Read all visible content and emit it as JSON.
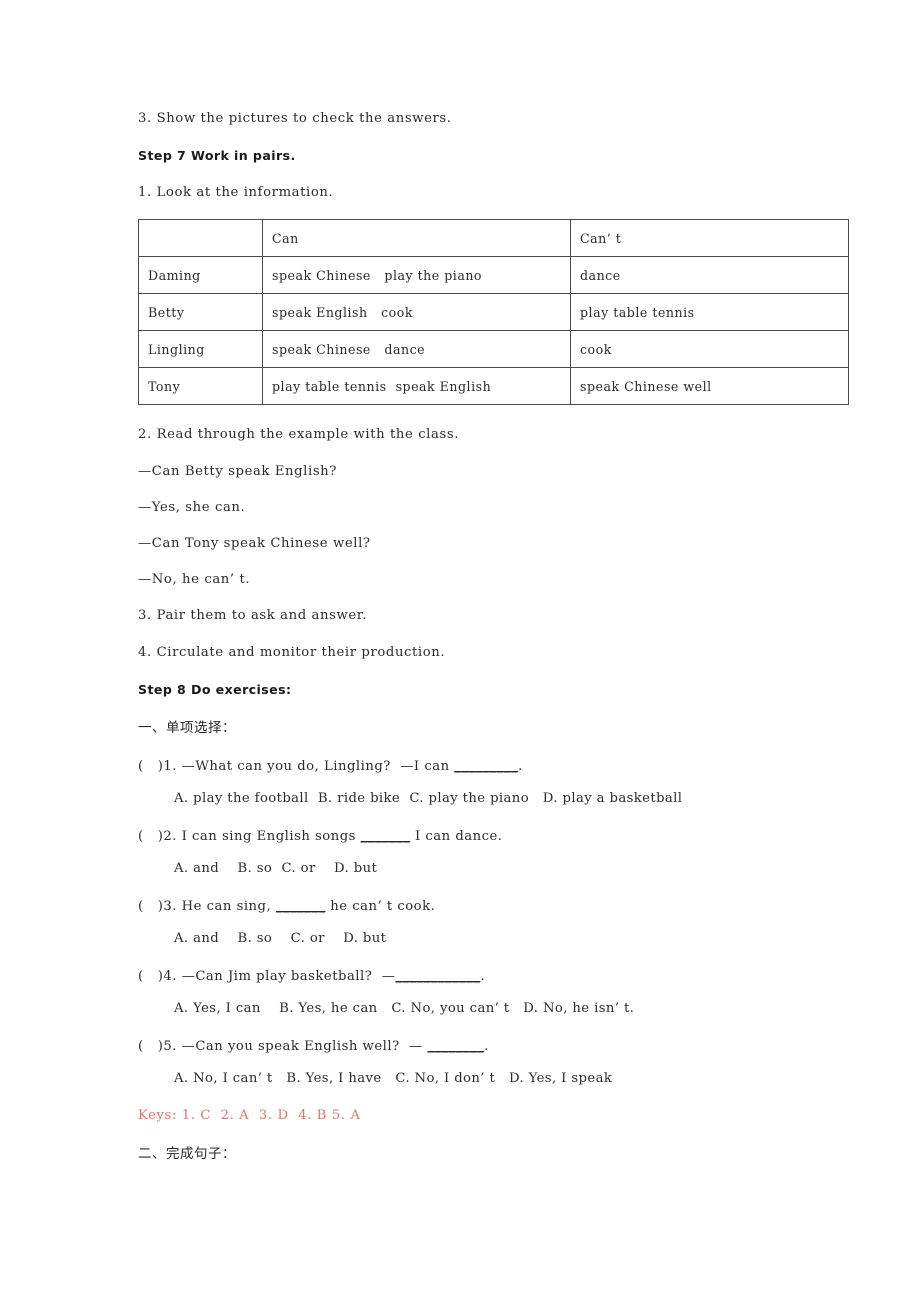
{
  "colors": {
    "text": "#2b2b2b",
    "keys_red": "#e2736e",
    "table_border": "#4a4a4a",
    "page_background": "#ffffff"
  },
  "document": {
    "intro_line": "3. Show the pictures to check the answers.",
    "step7": {
      "heading": "Step 7 Work in pairs.",
      "item1": "1. Look at the information.",
      "table": {
        "headers": [
          "",
          "Can",
          "Can’ t"
        ],
        "rows": [
          [
            "Daming",
            "speak Chinese   play the piano",
            "dance"
          ],
          [
            "Betty",
            "speak English   cook",
            "play table tennis"
          ],
          [
            "Lingling",
            "speak Chinese   dance",
            "cook"
          ],
          [
            "Tony",
            "play table tennis  speak English",
            "speak Chinese well"
          ]
        ]
      },
      "item2": "2. Read through the example with the class.",
      "dialogue": [
        "—Can Betty speak English?",
        "—Yes, she can.",
        "—Can Tony speak Chinese well?",
        "—No, he can’ t."
      ],
      "item3": "3. Pair them to ask and answer.",
      "item4": "4. Circulate and monitor their production."
    },
    "step8": {
      "heading": "Step 8 Do exercises:",
      "section1_title": "一、单项选择：",
      "questions": [
        {
          "stem_before": "(   )1. —What can you do, Lingling?  —I can ",
          "blank": "_________",
          "stem_after": ".",
          "options": "A. play the football  B. ride bike  C. play the piano   D. play a basketball"
        },
        {
          "stem_before": "(   )2. I can sing English songs ",
          "blank": "_______",
          "stem_after": " I can dance.",
          "options": "A. and    B. so  C. or    D. but"
        },
        {
          "stem_before": "(   )3. He can sing, ",
          "blank": "_______",
          "stem_after": " he can’ t cook.",
          "options": "A. and    B. so    C. or    D. but"
        },
        {
          "stem_before": "(   )4. —Can Jim play basketball?  —",
          "blank": "____________",
          "stem_after": ".",
          "options": "A. Yes, I can    B. Yes, he can   C. No, you can’ t   D. No, he isn’ t."
        },
        {
          "stem_before": "(   )5. —Can you speak English well?  — ",
          "blank": "________",
          "stem_after": ".",
          "options": "A. No, I can’ t   B. Yes, I have   C. No, I don’ t   D. Yes, I speak"
        }
      ],
      "keys": "Keys: 1. C  2. A  3. D  4. B 5. A",
      "section2_title": "二、完成句子："
    }
  }
}
